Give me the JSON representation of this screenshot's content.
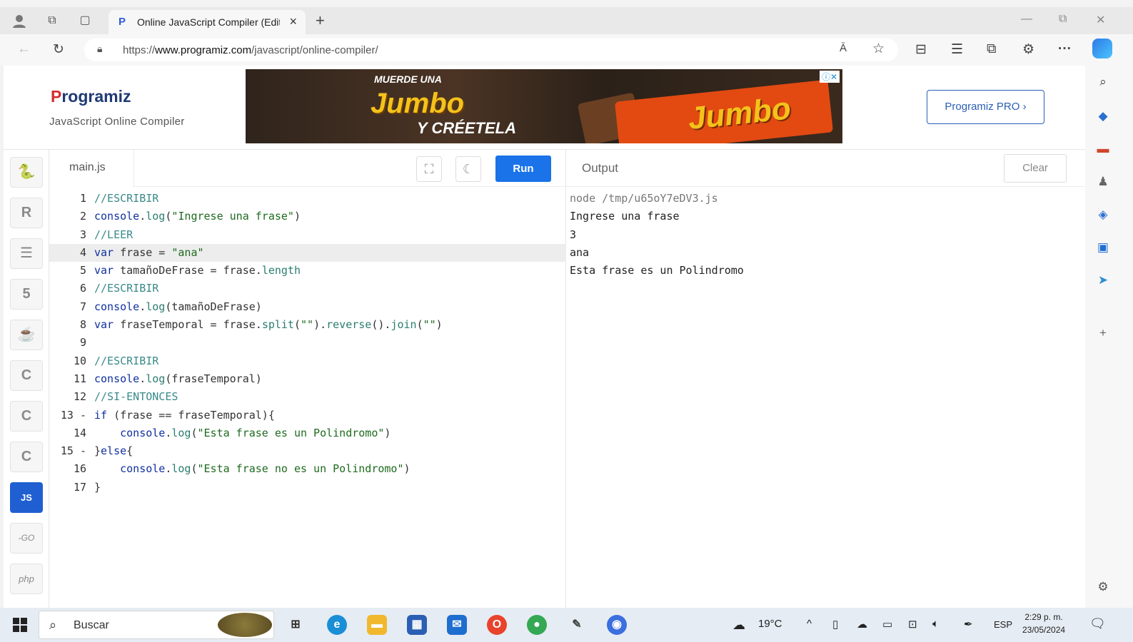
{
  "browser": {
    "tab_title": "Online JavaScript Compiler (Edito",
    "tab_close": "×",
    "new_tab": "+",
    "url_prefix": "https://",
    "url_host": "www.programiz.com",
    "url_path": "/javascript/online-compiler/",
    "reader_label": "Ā",
    "more_label": "···"
  },
  "header": {
    "logo_p": "P",
    "logo_rest": "rogramiz",
    "subtitle": "JavaScript Online Compiler",
    "pro_button": "Programiz PRO ›",
    "ad": {
      "line1": "MUERDE UNA",
      "line2": "Jumbo",
      "line3": "Y CRÉETELA",
      "brand": "Jumbo",
      "close": "ⓘ✕"
    }
  },
  "languages": [
    {
      "name": "python",
      "glyph": "🐍"
    },
    {
      "name": "r",
      "glyph": "R"
    },
    {
      "name": "sql",
      "glyph": "☰"
    },
    {
      "name": "html",
      "glyph": "5"
    },
    {
      "name": "java",
      "glyph": "☕"
    },
    {
      "name": "c",
      "glyph": "C"
    },
    {
      "name": "cpp",
      "glyph": "C"
    },
    {
      "name": "csharp",
      "glyph": "C"
    },
    {
      "name": "js",
      "glyph": "JS"
    },
    {
      "name": "go",
      "glyph": "-GO"
    },
    {
      "name": "php",
      "glyph": "php"
    }
  ],
  "editor": {
    "file_name": "main.js",
    "run_label": "Run",
    "lines": [
      {
        "n": "1",
        "code": "//ESCRIBIR"
      },
      {
        "n": "2",
        "code": "console.log(\"Ingrese una frase\")"
      },
      {
        "n": "3",
        "code": "//LEER"
      },
      {
        "n": "4",
        "code": "var frase = \"ana\""
      },
      {
        "n": "5",
        "code": "var tamañoDeFrase = frase.length"
      },
      {
        "n": "6",
        "code": "//ESCRIBIR"
      },
      {
        "n": "7",
        "code": "console.log(tamañoDeFrase)"
      },
      {
        "n": "8",
        "code": "var fraseTemporal = frase.split(\"\").reverse().join(\"\")"
      },
      {
        "n": "9",
        "code": ""
      },
      {
        "n": "10",
        "code": "//ESCRIBIR"
      },
      {
        "n": "11",
        "code": "console.log(fraseTemporal)"
      },
      {
        "n": "12",
        "code": "//SI-ENTONCES"
      },
      {
        "n": "13 -",
        "code": "if (frase == fraseTemporal){"
      },
      {
        "n": "14",
        "code": "    console.log(\"Esta frase es un Polindromo\")"
      },
      {
        "n": "15 -",
        "code": "}else{"
      },
      {
        "n": "16",
        "code": "    console.log(\"Esta frase no es un Polindromo\")"
      },
      {
        "n": "17",
        "code": "}"
      }
    ]
  },
  "output": {
    "title": "Output",
    "clear_label": "Clear",
    "lines": [
      "node /tmp/u65oY7eDV3.js",
      "Ingrese una frase",
      "3",
      "ana",
      "Esta frase es un Polindromo"
    ]
  },
  "taskbar": {
    "search_placeholder": "Buscar",
    "weather": "19°C",
    "lang": "ESP",
    "time": "2:29 p. m.",
    "date": "23/05/2024"
  },
  "colors": {
    "accent": "#1a73e8",
    "brand_navy": "#1f3a73",
    "brand_red": "#d62d2d",
    "comment": "#3a8a8a",
    "keyword": "#1030a0",
    "string": "#1e6b1e"
  }
}
